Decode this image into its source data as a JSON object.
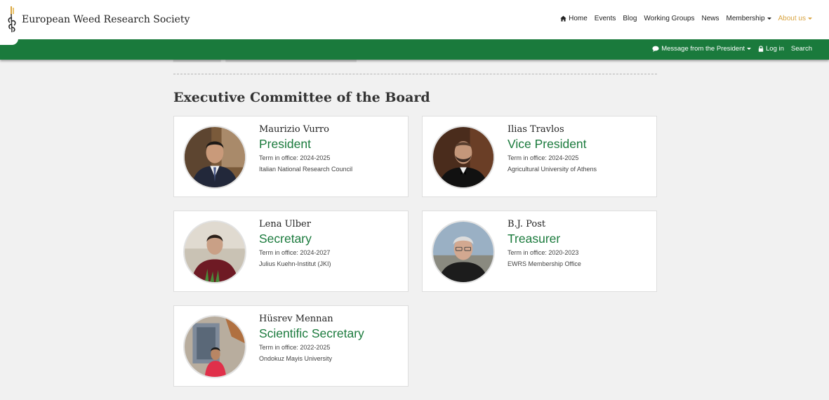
{
  "site": {
    "name": "European Weed Research Society"
  },
  "nav": {
    "home": "Home",
    "events": "Events",
    "blog": "Blog",
    "working_groups": "Working Groups",
    "news": "News",
    "membership": "Membership",
    "about": "About us"
  },
  "subnav": {
    "message": "Message from the President",
    "login": "Log in",
    "search": "Search"
  },
  "page": {
    "section_title": "Executive Committee of the Board"
  },
  "colors": {
    "brand_green": "#1a7a3c",
    "active_nav": "#d9a441"
  },
  "members": [
    {
      "name": "Maurizio Vurro",
      "role": "President",
      "term": "Term in office: 2024-2025",
      "org": "Italian National Research Council"
    },
    {
      "name": "Ilias Travlos",
      "role": "Vice President",
      "term": "Term in office: 2024-2025",
      "org": "Agricultural University of Athens"
    },
    {
      "name": "Lena Ulber",
      "role": "Secretary",
      "term": "Term in office: 2024-2027",
      "org": "Julius Kuehn-Institut (JKI)"
    },
    {
      "name": "B.J. Post",
      "role": "Treasurer",
      "term": "Term in office: 2020-2023",
      "org": "EWRS Membership Office"
    },
    {
      "name": "Hüsrev Mennan",
      "role": "Scientific Secretary",
      "term": "Term in office: 2022-2025",
      "org": "Ondokuz Mayis University"
    }
  ]
}
